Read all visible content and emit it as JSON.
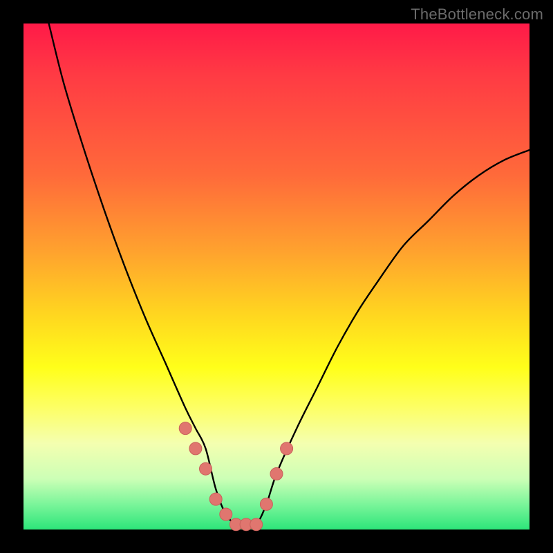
{
  "watermark": "TheBottleneck.com",
  "colors": {
    "frame": "#000000",
    "curve": "#000000",
    "marker_fill": "#e0766f",
    "marker_stroke": "#c9605a"
  },
  "chart_data": {
    "type": "line",
    "title": "",
    "xlabel": "",
    "ylabel": "",
    "xlim": [
      0,
      100
    ],
    "ylim": [
      0,
      100
    ],
    "note": "Bottleneck-style notch curve. x is normalized horizontal position (0=left of plot, 100=right). y is normalized vertical position (0=top of plot, 100=bottom). Curve reaches bottom (y≈100) near x≈38–46; markers highlight the segment around the trough.",
    "series": [
      {
        "name": "curve",
        "x": [
          5,
          8,
          12,
          16,
          20,
          24,
          28,
          32,
          34,
          36,
          38,
          40,
          42,
          44,
          46,
          48,
          50,
          54,
          58,
          62,
          66,
          70,
          75,
          80,
          85,
          90,
          95,
          100
        ],
        "y": [
          0,
          12,
          25,
          37,
          48,
          58,
          67,
          76,
          80,
          84,
          92,
          97,
          99,
          99,
          99,
          95,
          89,
          80,
          72,
          64,
          57,
          51,
          44,
          39,
          34,
          30,
          27,
          25
        ]
      }
    ],
    "markers": {
      "name": "highlight",
      "x": [
        32,
        34,
        36,
        38,
        40,
        42,
        44,
        46,
        48,
        50,
        52
      ],
      "y": [
        80,
        84,
        88,
        94,
        97,
        99,
        99,
        99,
        95,
        89,
        84
      ]
    }
  }
}
